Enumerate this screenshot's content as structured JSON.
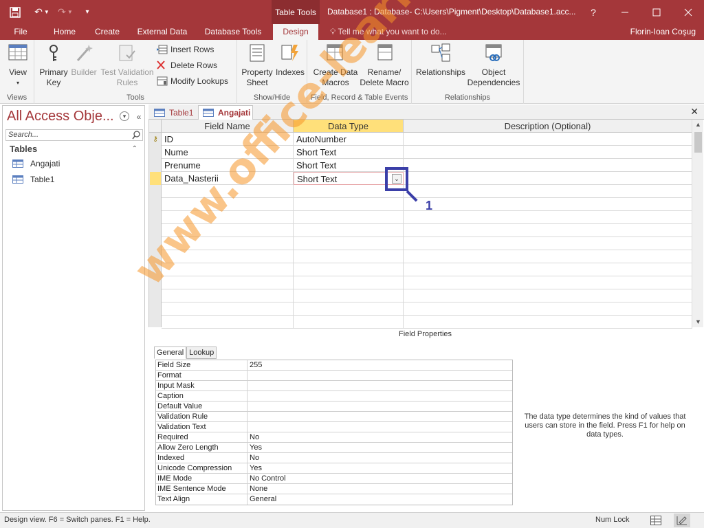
{
  "titlebar": {
    "contextual_tab": "Table Tools",
    "doc_title": "Database1 : Database- C:\\Users\\Pigment\\Desktop\\Database1.acc...",
    "help": "?"
  },
  "ribbon_tabs": [
    "File",
    "Home",
    "Create",
    "External Data",
    "Database Tools",
    "Design"
  ],
  "tell_me": "Tell me what you want to do...",
  "user": "Florin-Ioan Coşug",
  "ribbon": {
    "views": {
      "group": "Views",
      "view_label": "View"
    },
    "tools": {
      "group": "Tools",
      "primary_key": "Primary Key",
      "builder": "Builder",
      "test_validation": "Test Validation Rules",
      "insert_rows": "Insert Rows",
      "delete_rows": "Delete Rows",
      "modify_lookups": "Modify Lookups"
    },
    "showhide": {
      "group": "Show/Hide",
      "property_sheet": "Property Sheet",
      "indexes": "Indexes"
    },
    "events": {
      "group": "Field, Record & Table Events",
      "create_data_macros": "Create Data Macros",
      "rename_delete_macro": "Rename/ Delete Macro"
    },
    "relationships": {
      "group": "Relationships",
      "relationships": "Relationships",
      "object_dependencies": "Object Dependencies"
    }
  },
  "nav": {
    "title": "All Access Obje...",
    "search_placeholder": "Search...",
    "section": "Tables",
    "items": [
      "Angajati",
      "Table1"
    ]
  },
  "doc_tabs": [
    "Table1",
    "Angajati"
  ],
  "grid": {
    "headers": [
      "Field Name",
      "Data Type",
      "Description (Optional)"
    ],
    "rows": [
      {
        "name": "ID",
        "type": "AutoNumber",
        "desc": "",
        "key": true
      },
      {
        "name": "Nume",
        "type": "Short Text",
        "desc": ""
      },
      {
        "name": "Prenume",
        "type": "Short Text",
        "desc": ""
      },
      {
        "name": "Data_Nasterii",
        "type": "Short Text",
        "desc": "",
        "current": true
      }
    ],
    "empty_rows": 11
  },
  "annotation": {
    "number": "1"
  },
  "field_properties": {
    "title": "Field Properties",
    "tabs": [
      "General",
      "Lookup"
    ],
    "props": [
      {
        "name": "Field Size",
        "value": "255"
      },
      {
        "name": "Format",
        "value": ""
      },
      {
        "name": "Input Mask",
        "value": ""
      },
      {
        "name": "Caption",
        "value": ""
      },
      {
        "name": "Default Value",
        "value": ""
      },
      {
        "name": "Validation Rule",
        "value": ""
      },
      {
        "name": "Validation Text",
        "value": ""
      },
      {
        "name": "Required",
        "value": "No"
      },
      {
        "name": "Allow Zero Length",
        "value": "Yes"
      },
      {
        "name": "Indexed",
        "value": "No"
      },
      {
        "name": "Unicode Compression",
        "value": "Yes"
      },
      {
        "name": "IME Mode",
        "value": "No Control"
      },
      {
        "name": "IME Sentence Mode",
        "value": "None"
      },
      {
        "name": "Text Align",
        "value": "General"
      }
    ],
    "help": "The data type determines the kind of values that users can store in the field. Press F1 for help on data types."
  },
  "watermark": "www.office-learning.ro",
  "status": {
    "text": "Design view.  F6 = Switch panes.  F1 = Help.",
    "numlock": "Num Lock"
  },
  "colors": {
    "accent": "#a4373a",
    "highlight": "#ffe07a",
    "marker": "#3b3fa8",
    "watermark": "#f59628"
  }
}
